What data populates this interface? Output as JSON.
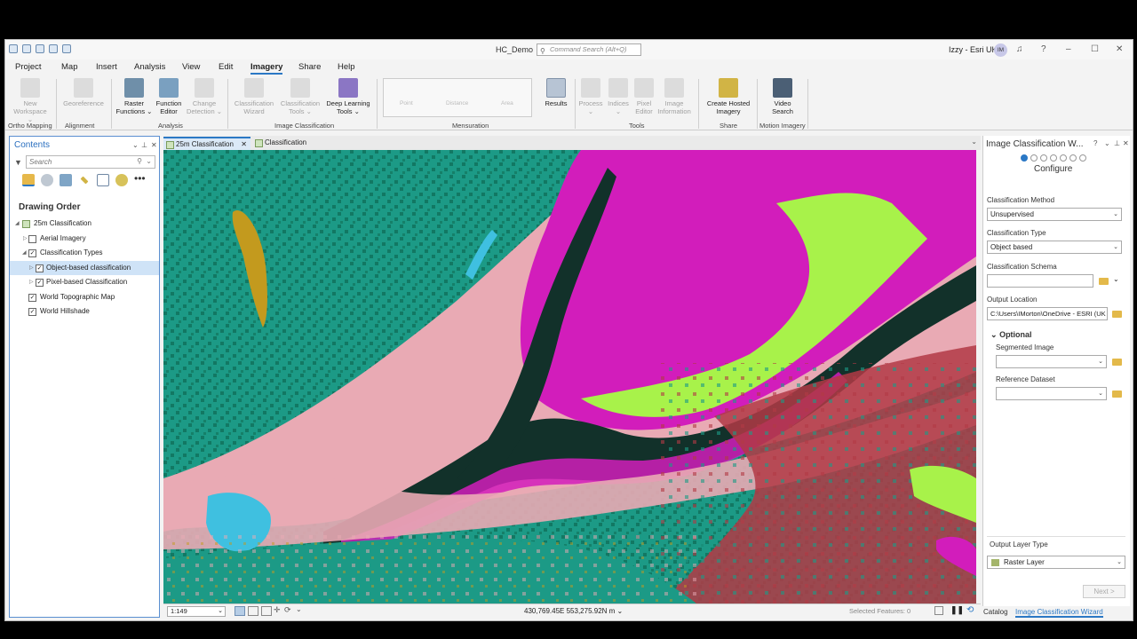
{
  "app": {
    "title": "HC_Demo",
    "command_search_placeholder": "Command Search (Alt+Q)",
    "user": "Izzy - Esri UK",
    "user_initials": "IM"
  },
  "menu_tabs": [
    "Project",
    "Map",
    "Insert",
    "Analysis",
    "View",
    "Edit",
    "Imagery",
    "Share",
    "Help"
  ],
  "active_tab": "Imagery",
  "ribbon": {
    "new_workspace": "New\nWorkspace ⌄",
    "georeference": "Georeference",
    "raster_functions": "Raster\nFunctions ⌄",
    "function_editor": "Function\nEditor",
    "change_detection": "Change\nDetection ⌄",
    "classification_wizard": "Classification\nWizard",
    "classification_tools": "Classification\nTools ⌄",
    "deep_learning_tools": "Deep Learning\nTools ⌄",
    "point": "Point",
    "distance": "Distance",
    "area": "Area",
    "results": "Results",
    "process": "Process\n⌄",
    "indices": "Indices\n⌄",
    "pixel_editor": "Pixel\nEditor",
    "image_information": "Image\nInformation",
    "create_hosted_imagery": "Create Hosted\nImagery",
    "video_search": "Video\nSearch",
    "groups": {
      "ortho_mapping": "Ortho Mapping",
      "alignment": "Alignment",
      "analysis": "Analysis",
      "image_classification": "Image Classification",
      "mensuration": "Mensuration",
      "tools": "Tools",
      "share": "Share",
      "motion_imagery": "Motion Imagery"
    }
  },
  "contents": {
    "title": "Contents",
    "search_placeholder": "Search",
    "drawing_order": "Drawing Order",
    "layers": [
      {
        "label": "25m Classification",
        "level": 0,
        "checked": null
      },
      {
        "label": "Aerial Imagery",
        "level": 1,
        "checked": false
      },
      {
        "label": "Classification Types",
        "level": 1,
        "checked": true
      },
      {
        "label": "Object-based classification",
        "level": 2,
        "checked": true
      },
      {
        "label": "Pixel-based Classification",
        "level": 2,
        "checked": true
      },
      {
        "label": "World Topographic Map",
        "level": 1,
        "checked": true
      },
      {
        "label": "World Hillshade",
        "level": 1,
        "checked": true
      }
    ]
  },
  "map_tabs": [
    "25m Classification",
    "Classification"
  ],
  "map": {
    "scale": "1:149",
    "coordinates": "430,769.45E 553,275.92N m",
    "selected_features": "Selected Features: 0",
    "class_colors": {
      "forest": "#1c9a86",
      "dark_forest": "#0f6f5a",
      "pink": "#e9aab4",
      "magenta": "#d21dbb",
      "lime": "#a8f24a",
      "dark": "#12312a",
      "red": "#b23a45",
      "ochre": "#c39a1e",
      "cyan": "#3fc0e0"
    }
  },
  "wizard": {
    "title": "Image Classification W...",
    "step": "Configure",
    "classification_method_label": "Classification Method",
    "classification_method": "Unsupervised",
    "classification_type_label": "Classification Type",
    "classification_type": "Object based",
    "classification_schema_label": "Classification Schema",
    "output_location_label": "Output Location",
    "output_location": "C:\\Users\\IMorton\\OneDrive - ESRI (UK",
    "optional": "Optional",
    "segmented_image_label": "Segmented Image",
    "reference_dataset_label": "Reference Dataset",
    "output_layer_type_label": "Output Layer Type",
    "output_layer_type": "Raster Layer",
    "next": "Next >"
  },
  "bottom_tabs": [
    "Catalog",
    "Image Classification Wizard"
  ]
}
